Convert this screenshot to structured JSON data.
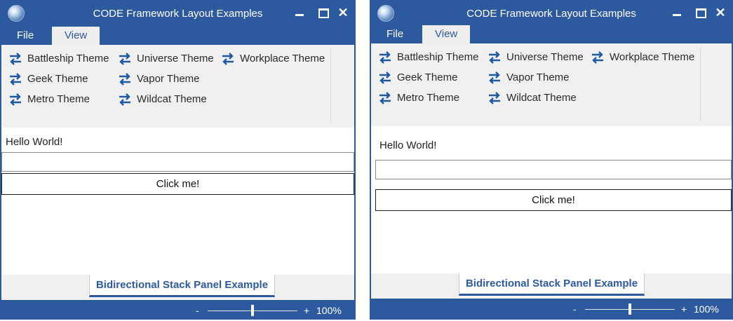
{
  "window": {
    "title": "CODE Framework Layout Examples",
    "minimize_symbol": "",
    "close_symbol": "✕"
  },
  "menu": {
    "file_label": "File",
    "view_label": "View"
  },
  "themes": {
    "battleship": "Battleship Theme",
    "universe": "Universe Theme",
    "workplace": "Workplace Theme",
    "geek": "Geek Theme",
    "vapor": "Vapor Theme",
    "metro": "Metro Theme",
    "wildcat": "Wildcat Theme"
  },
  "content": {
    "hello_text": "Hello World!",
    "input_value": "",
    "button_label": "Click me!"
  },
  "tab": {
    "label": "Bidirectional Stack Panel Example"
  },
  "status": {
    "zoom_minus": "-",
    "zoom_plus": "+",
    "zoom_value": "100%",
    "zoom_level_percent": 100
  },
  "colors": {
    "chrome_blue": "#2d5a9e",
    "ribbon_gray": "#f0f0f0",
    "icon_blue": "#1f5aa0"
  }
}
